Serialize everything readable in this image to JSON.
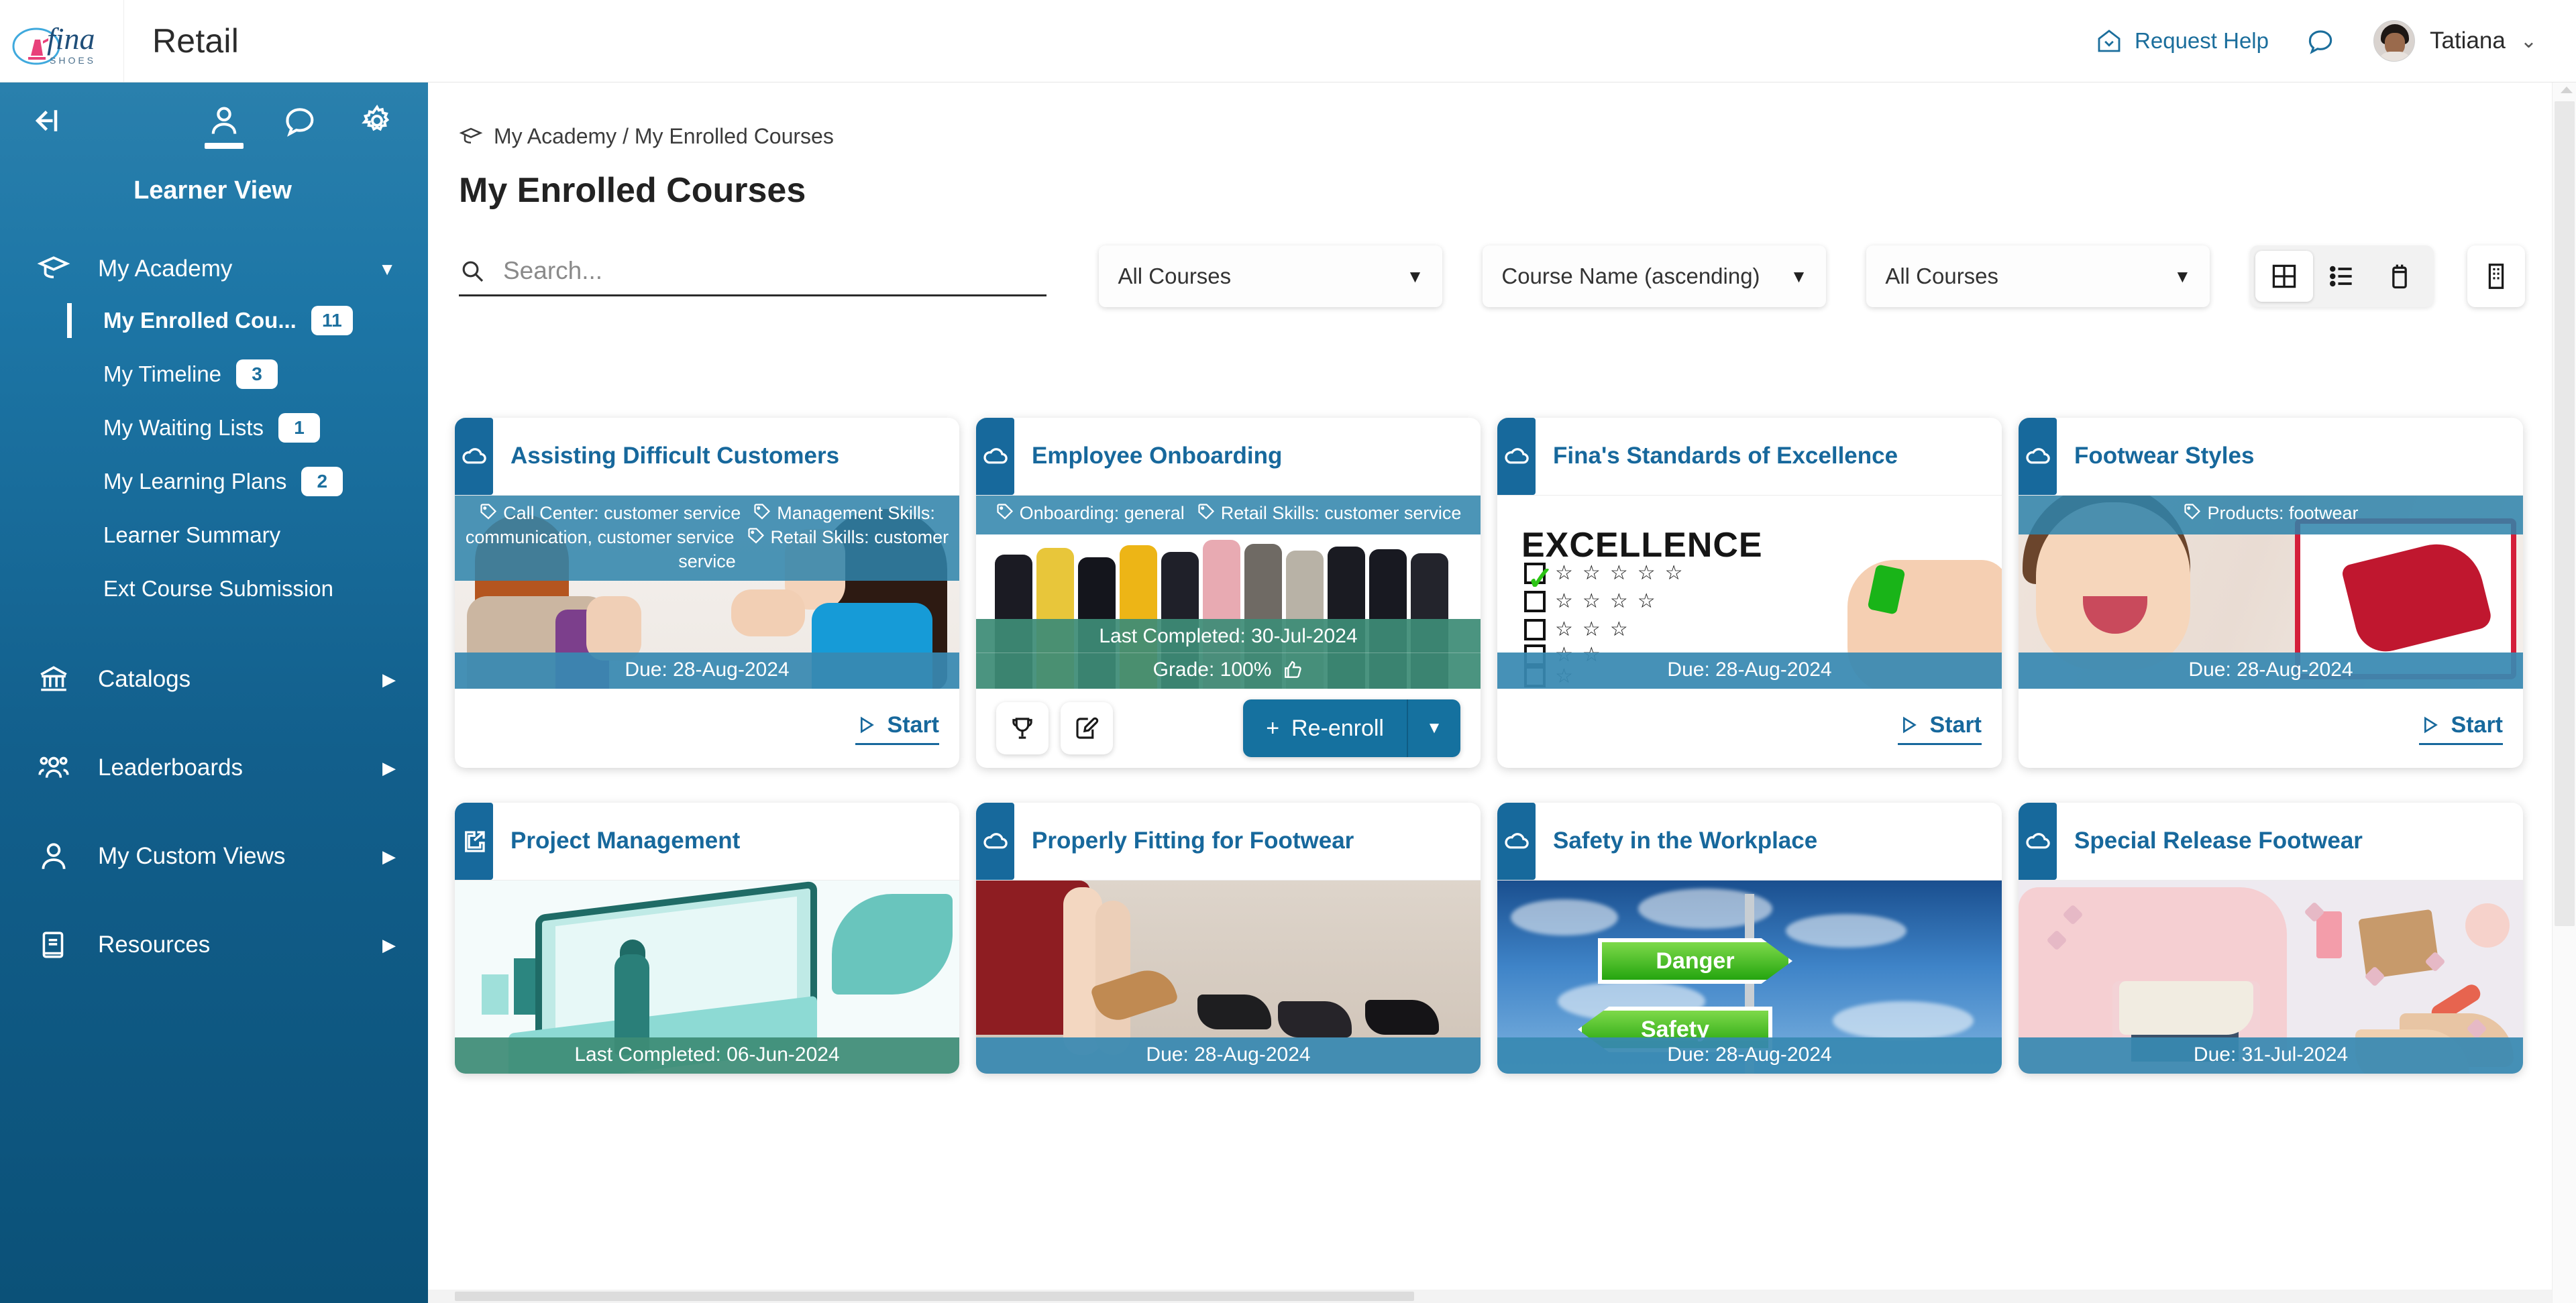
{
  "header": {
    "logo_name": "fina SHOES",
    "logo_main": "fina",
    "logo_sub": "SHOES",
    "app_title": "Retail",
    "request_help": "Request Help",
    "user_name": "Tatiana",
    "user_caret": "⌄",
    "icons": {
      "help": "home-help-icon",
      "chat": "chat-bubble-icon",
      "avatar": "user-avatar",
      "caret": "chevron-down-icon"
    }
  },
  "sidebar": {
    "view_label": "Learner View",
    "collapse_icon": "collapse-sidebar-icon",
    "tabs": [
      {
        "icon": "person-icon",
        "name": "learner-view-tab",
        "active": true
      },
      {
        "icon": "chat-bubble-icon",
        "name": "messages-tab",
        "active": false
      },
      {
        "icon": "gear-icon",
        "name": "settings-tab",
        "active": false
      }
    ],
    "groups": [
      {
        "label": "My Academy",
        "icon": "graduation-cap-icon",
        "arrow": "▼",
        "expanded": true,
        "items": [
          {
            "label": "My Enrolled Cou...",
            "badge": "11",
            "active": true
          },
          {
            "label": "My Timeline",
            "badge": "3",
            "active": false
          },
          {
            "label": "My Waiting Lists",
            "badge": "1",
            "active": false
          },
          {
            "label": "My Learning Plans",
            "badge": "2",
            "active": false
          },
          {
            "label": "Learner Summary",
            "badge": "",
            "active": false
          },
          {
            "label": "Ext Course Submission",
            "badge": "",
            "active": false
          }
        ]
      },
      {
        "label": "Catalogs",
        "icon": "bank-columns-icon",
        "arrow": "▶",
        "expanded": false,
        "items": []
      },
      {
        "label": "Leaderboards",
        "icon": "people-group-icon",
        "arrow": "▶",
        "expanded": false,
        "items": []
      },
      {
        "label": "My Custom Views",
        "icon": "person-icon",
        "arrow": "▶",
        "expanded": false,
        "items": []
      },
      {
        "label": "Resources",
        "icon": "book-icon",
        "arrow": "▶",
        "expanded": false,
        "items": []
      }
    ]
  },
  "main": {
    "breadcrumb": "My Academy / My Enrolled Courses",
    "breadcrumb_icon": "graduation-cap-icon",
    "page_title": "My Enrolled Courses",
    "toolbar": {
      "search_placeholder": "Search...",
      "search_value": "",
      "search_icon": "search-icon",
      "filter1": {
        "value": "All Courses",
        "caret": "▼"
      },
      "sort": {
        "value": "Course Name (ascending)",
        "caret": "▼"
      },
      "filter2": {
        "value": "All Courses",
        "caret": "▼"
      },
      "view_modes": [
        {
          "name": "grid-view-button",
          "icon": "grid-icon",
          "active": true
        },
        {
          "name": "list-view-button",
          "icon": "list-icon",
          "active": false
        },
        {
          "name": "calendar-view-button",
          "icon": "calendar-icon",
          "active": false
        }
      ],
      "org_button": {
        "name": "building-view-button",
        "icon": "building-icon"
      }
    },
    "cards": [
      {
        "title": "Assisting Difficult Customers",
        "type_icon": "cloud-icon",
        "tags": [
          "Call Center: customer service",
          "Management Skills: communication, customer service",
          "Retail Skills: customer service"
        ],
        "status_label": "Due: 28-Aug-2024",
        "status_type": "due",
        "grade": "",
        "action": "Start",
        "action_icon": "play-icon",
        "art": "argue"
      },
      {
        "title": "Employee Onboarding",
        "type_icon": "cloud-icon",
        "tags": [
          "Onboarding: general",
          "Retail Skills: customer service"
        ],
        "status_label": "Last Completed: 30-Jul-2024",
        "status_type": "done",
        "grade": "Grade: 100%",
        "grade_icon": "thumbs-up-icon",
        "action": "Re-enroll",
        "action_icon": "plus-icon",
        "action_caret": "▼",
        "extra_buttons": [
          {
            "name": "trophy-button",
            "icon": "trophy-icon"
          },
          {
            "name": "edit-button",
            "icon": "edit-pencil-icon"
          }
        ],
        "art": "group"
      },
      {
        "title": "Fina's Standards of Excellence",
        "type_icon": "cloud-icon",
        "tags": [],
        "status_label": "Due: 28-Aug-2024",
        "status_type": "due",
        "grade": "",
        "action": "Start",
        "action_icon": "play-icon",
        "art": "excellence",
        "art_text": "EXCELLENCE"
      },
      {
        "title": "Footwear Styles",
        "type_icon": "cloud-icon",
        "tags": [
          "Products: footwear"
        ],
        "status_label": "Due: 28-Aug-2024",
        "status_type": "due",
        "grade": "",
        "action": "Start",
        "action_icon": "play-icon",
        "art": "shoebox"
      },
      {
        "title": "Project Management",
        "type_icon": "external-link-icon",
        "tags": [],
        "status_label": "Last Completed: 06-Jun-2024",
        "status_type": "done",
        "grade": "",
        "action": "",
        "art": "pm"
      },
      {
        "title": "Properly Fitting for Footwear",
        "type_icon": "cloud-icon",
        "tags": [],
        "status_label": "Due: 28-Aug-2024",
        "status_type": "due",
        "grade": "",
        "action": "",
        "art": "fitting"
      },
      {
        "title": "Safety in the Workplace",
        "type_icon": "cloud-icon",
        "tags": [],
        "status_label": "Due: 28-Aug-2024",
        "status_type": "due",
        "grade": "",
        "action": "",
        "art": "safety",
        "art_text_1": "Danger",
        "art_text_2": "Safety"
      },
      {
        "title": "Special Release Footwear",
        "type_icon": "cloud-icon",
        "tags": [],
        "status_label": "Due: 31-Jul-2024",
        "status_type": "due",
        "grade": "",
        "action": "",
        "art": "flatlay"
      }
    ]
  },
  "colors": {
    "brand_blue": "#17689c",
    "sidebar_top": "#2a80ad",
    "sidebar_bottom": "#0b5178",
    "tag_bar": "#2f83ab",
    "due_bar": "#3889b1",
    "completed_bar": "#3d8c76",
    "accent_button": "#15719f"
  }
}
